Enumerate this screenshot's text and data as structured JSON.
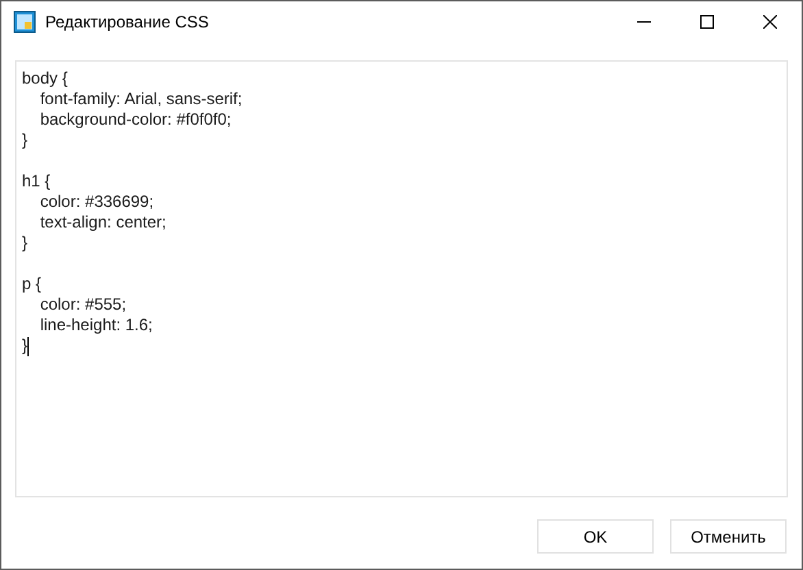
{
  "window": {
    "title": "Редактирование CSS"
  },
  "editor": {
    "blocks": [
      [
        "body {",
        "    font-family: Arial, sans-serif;",
        "    background-color: #f0f0f0;",
        "}"
      ],
      [
        "h1 {",
        "    color: #336699;",
        "    text-align: center;",
        "}"
      ],
      [
        "p {",
        "    color: #555;",
        "    line-height: 1.6;",
        "}"
      ]
    ]
  },
  "buttons": [
    "OK",
    "Отменить"
  ]
}
